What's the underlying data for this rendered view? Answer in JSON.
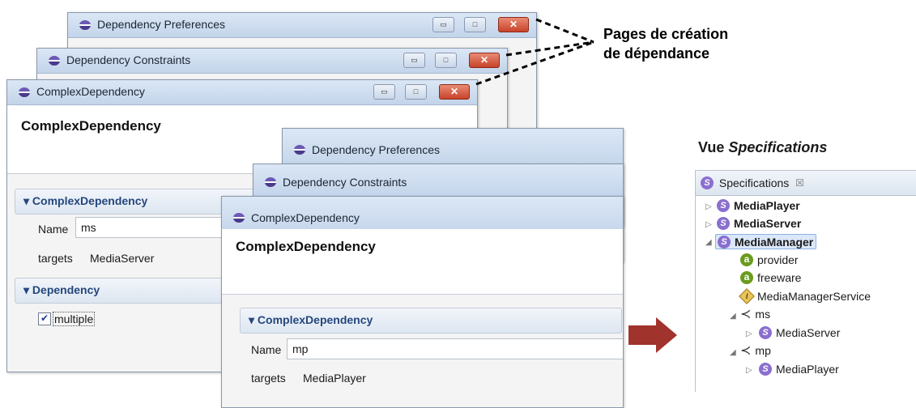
{
  "callout": {
    "line1": "Pages de création",
    "line2": "de dépendance"
  },
  "view_caption": {
    "prefix": "Vue ",
    "emphasis": "Specifications"
  },
  "window_controls": {
    "minimize": "▭",
    "maximize": "□",
    "close": "✕"
  },
  "left_stack": {
    "back_title": "Dependency Preferences",
    "middle_title": "Dependency Constraints",
    "front_title": "ComplexDependency",
    "header": "ComplexDependency",
    "section1": "ComplexDependency",
    "name_label": "Name",
    "name_value": "ms",
    "targets_label": "targets",
    "targets_value": "MediaServer",
    "section2": "Dependency",
    "checkbox_label": "multiple",
    "checkbox_checked": true
  },
  "right_stack": {
    "back_title": "Dependency Preferences",
    "middle_title": "Dependency Constraints",
    "front_title": "ComplexDependency",
    "header": "ComplexDependency",
    "section1": "ComplexDependency",
    "name_label": "Name",
    "name_value": "mp",
    "targets_label": "targets",
    "targets_value": "MediaPlayer"
  },
  "specifications_view": {
    "tab_label": "Specifications",
    "tab_close": "☒",
    "tree": [
      {
        "label": "MediaPlayer",
        "icon": "specification-icon",
        "expanded": false,
        "bold": true
      },
      {
        "label": "MediaServer",
        "icon": "specification-icon",
        "expanded": false,
        "bold": true
      },
      {
        "label": "MediaManager",
        "icon": "specification-icon",
        "expanded": true,
        "bold": true,
        "selected": true
      },
      {
        "label": "provider",
        "icon": "attribute-icon"
      },
      {
        "label": "freeware",
        "icon": "attribute-icon"
      },
      {
        "label": "MediaManagerService",
        "icon": "interface-icon"
      },
      {
        "label": "ms",
        "icon": "dependency-icon",
        "expanded": true
      },
      {
        "label": "MediaServer",
        "icon": "specification-icon",
        "expanded": false
      },
      {
        "label": "mp",
        "icon": "dependency-icon",
        "expanded": true
      },
      {
        "label": "MediaPlayer",
        "icon": "specification-icon",
        "expanded": false
      }
    ]
  },
  "colors": {
    "arrow": "#a0332b",
    "section_text": "#24477d",
    "spec_icon": "#8a6fcf",
    "attr_icon": "#6a9b1e"
  }
}
